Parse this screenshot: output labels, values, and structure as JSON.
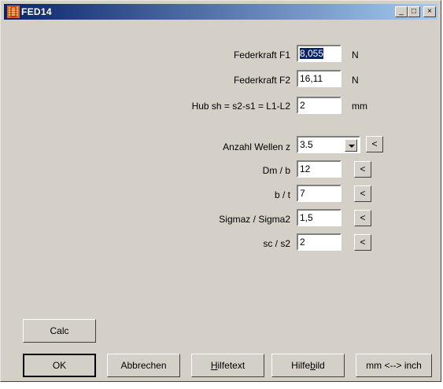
{
  "window": {
    "title": "FED14"
  },
  "titlebar_buttons": {
    "minimize": "_",
    "maximize": "□",
    "close": "×"
  },
  "fields": [
    {
      "label": "Federkraft F1",
      "value": "8,055",
      "unit": "N"
    },
    {
      "label": "Federkraft F2",
      "value": "16,11",
      "unit": "N"
    },
    {
      "label": "Hub sh = s2-s1 = L1-L2",
      "value": "2",
      "unit": "mm"
    }
  ],
  "params": {
    "wellen": {
      "label": "Anzahl Wellen z",
      "value": "3.5"
    },
    "dm_b": {
      "label": "Dm / b",
      "value": "12"
    },
    "b_t": {
      "label": "b / t",
      "value": "7"
    },
    "sigma": {
      "label": "Sigmaz / Sigma2",
      "value": "1,5"
    },
    "sc_s2": {
      "label": "sc / s2",
      "value": "2"
    },
    "arrow": "<"
  },
  "buttons": {
    "calc": "Calc",
    "ok": "OK",
    "abbrechen": "Abbrechen",
    "hilfetext_u": "H",
    "hilfetext_rest": "ilfetext",
    "hilfebild_pre": "Hilfe",
    "hilfebild_u": "b",
    "hilfebild_rest": "ild",
    "units": "mm <--> inch"
  }
}
